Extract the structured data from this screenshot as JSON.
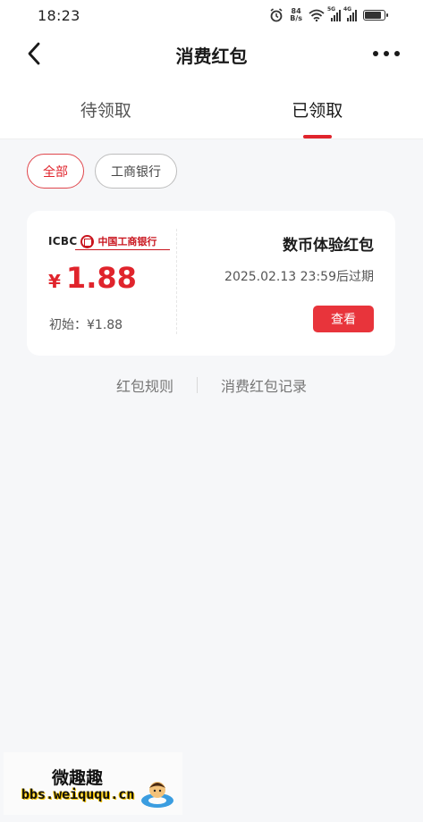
{
  "status_bar": {
    "time": "18:23",
    "net_speed_value": "84",
    "net_speed_unit": "B/s",
    "sig1_tag": "5G",
    "sig2_tag": "4G"
  },
  "nav": {
    "title": "消费红包"
  },
  "tabs": [
    {
      "label": "待领取",
      "active": false
    },
    {
      "label": "已领取",
      "active": true
    }
  ],
  "filters": [
    {
      "label": "全部",
      "active": true
    },
    {
      "label": "工商银行",
      "active": false
    }
  ],
  "card": {
    "bank_abbr": "ICBC",
    "bank_name": "中国工商银行",
    "currency": "¥",
    "amount": "1.88",
    "original_label": "初始：¥1.88",
    "title": "数币体验红包",
    "expire": "2025.02.13 23:59后过期",
    "view_button": "查看"
  },
  "links": {
    "rules": "红包规则",
    "records": "消费红包记录"
  },
  "watermark": {
    "title": "微趣趣",
    "url": "bbs.weiququ.cn"
  },
  "colors": {
    "accent": "#e0242c",
    "button": "#e8343b",
    "background": "#f6f7f9"
  }
}
